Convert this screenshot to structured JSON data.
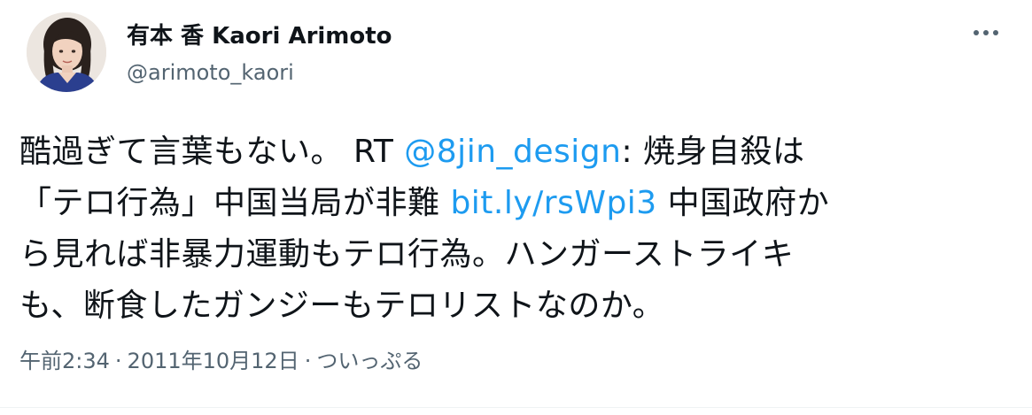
{
  "author": {
    "name": "有本 香 Kaori Arimoto",
    "handle": "@arimoto_kaori"
  },
  "icons": {
    "more": "more-horizontal-icon"
  },
  "tweet": {
    "line1": {
      "text_before": "酷過ぎて言葉もない。 RT ",
      "mention": "@8jin_design",
      "text_after": ": 焼身自殺は"
    },
    "line2": {
      "text_before": "「テロ行為」中国当局が非難 ",
      "link": "bit.ly/rsWpi3",
      "text_after": " 中国政府か"
    },
    "line3": "ら見れば非暴力運動もテロ行為。ハンガーストライキ",
    "line4": "も、断食したガンジーもテロリストなのか。"
  },
  "meta": {
    "time": "午前2:34",
    "separator": "·",
    "date": "2011年10月12日",
    "source": "ついっぷる"
  },
  "colors": {
    "text": "#0f1419",
    "secondary": "#536471",
    "link": "#1d9bf0"
  }
}
